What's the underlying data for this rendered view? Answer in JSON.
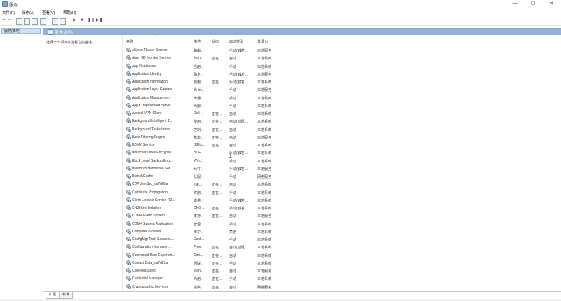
{
  "window": {
    "title": "服务",
    "min_label": "—",
    "max_label": "☐",
    "close_label": "✕"
  },
  "menu": [
    "文件(F)",
    "操作(A)",
    "查看(V)",
    "帮助(H)"
  ],
  "toolbar": {
    "back": "⇦",
    "forward": "⇨",
    "play": "▶",
    "stop": "■",
    "pause": "❚❚",
    "restart": "▶❚"
  },
  "tree": {
    "selected": "服务(本地)"
  },
  "main": {
    "header": "服务(本地)",
    "description": "选择一个项目来查看它的描述。",
    "columns": [
      "名称",
      "描述",
      "状态",
      "启动类型",
      "登录为"
    ],
    "sort_indicator": "^",
    "rows": [
      [
        "AllJoyn Router Service",
        "路由...",
        "",
        "手动(触发...",
        "本地服务"
      ],
      [
        "Alps HID Monitor Service",
        "Mon...",
        "正在...",
        "自动",
        "本地系统"
      ],
      [
        "App Readiness",
        "当用...",
        "",
        "手动",
        "本地系统"
      ],
      [
        "Application Identity",
        "确定...",
        "",
        "手动(触发...",
        "本地服务"
      ],
      [
        "Application Information",
        "使用...",
        "正在...",
        "手动(触发...",
        "本地系统"
      ],
      [
        "Application Layer Gatewa...",
        "为 In...",
        "",
        "手动",
        "本地服务"
      ],
      [
        "Application Management",
        "为通...",
        "",
        "手动",
        "本地系统"
      ],
      [
        "AppX Deployment Servic...",
        "为部...",
        "",
        "手动",
        "本地系统"
      ],
      [
        "Axestel VPN Client",
        "Dell ...",
        "正在...",
        "自动",
        "本地系统"
      ],
      [
        "Background Intelligent T...",
        "使用...",
        "正在...",
        "自动(延迟...",
        "本地系统"
      ],
      [
        "Background Tasks Infras...",
        "控制...",
        "正在...",
        "自动",
        "本地系统"
      ],
      [
        "Base Filtering Engine",
        "基本...",
        "正在...",
        "自动",
        "本地服务"
      ],
      [
        "BDMY Service",
        "BIDis...",
        "正在...",
        "自动",
        "本地系统"
      ],
      [
        "BitLocker Drive Encryptio...",
        "BDE...",
        "",
        "手动(触发...",
        "本地系统"
      ],
      [
        "Block Level Backup Engi...",
        "Win...",
        "",
        "手动",
        "本地系统"
      ],
      [
        "Bluetooth Handsfree Ser...",
        "允许...",
        "",
        "手动(触发...",
        "本地服务"
      ],
      [
        "BranchCache",
        "此服...",
        "",
        "手动",
        "网络服务"
      ],
      [
        "CDPUserSvc_ca7d83a",
        "<读...",
        "正在...",
        "自动",
        "本地系统"
      ],
      [
        "Certificate Propagation",
        "将用...",
        "正在...",
        "手动",
        "本地系统"
      ],
      [
        "Client License Service (Cl...",
        "提供...",
        "",
        "手动(触发...",
        "本地系统"
      ],
      [
        "CNG Key Isolation",
        "CNG ...",
        "正在...",
        "手动(触发...",
        "本地系统"
      ],
      [
        "COM+ Event System",
        "支持...",
        "正在...",
        "自动",
        "本地服务"
      ],
      [
        "COM+ System Application",
        "管理...",
        "",
        "手动",
        "本地系统"
      ],
      [
        "Computer Browser",
        "维护...",
        "",
        "禁用",
        "本地系统"
      ],
      [
        "ConfigMgr Task Sequenc...",
        "Conf...",
        "",
        "手动",
        "本地系统"
      ],
      [
        "Configuration Manager ...",
        "Prov...",
        "正在...",
        "自动(延迟...",
        "本地系统"
      ],
      [
        "Connected User Experien...",
        "Con...",
        "正在...",
        "自动",
        "本地系统"
      ],
      [
        "Contact Data_ca7d83a",
        "为联...",
        "正在...",
        "手动",
        "本地系统"
      ],
      [
        "CoreMessaging",
        "Man...",
        "正在...",
        "自动",
        "本地服务"
      ],
      [
        "Credential Manager",
        "为用...",
        "正在...",
        "手动",
        "本地系统"
      ],
      [
        "Cryptographic Services",
        "提供...",
        "正在...",
        "自动",
        "网络服务"
      ]
    ]
  },
  "bottom_tabs": [
    "扩展",
    "标准"
  ]
}
